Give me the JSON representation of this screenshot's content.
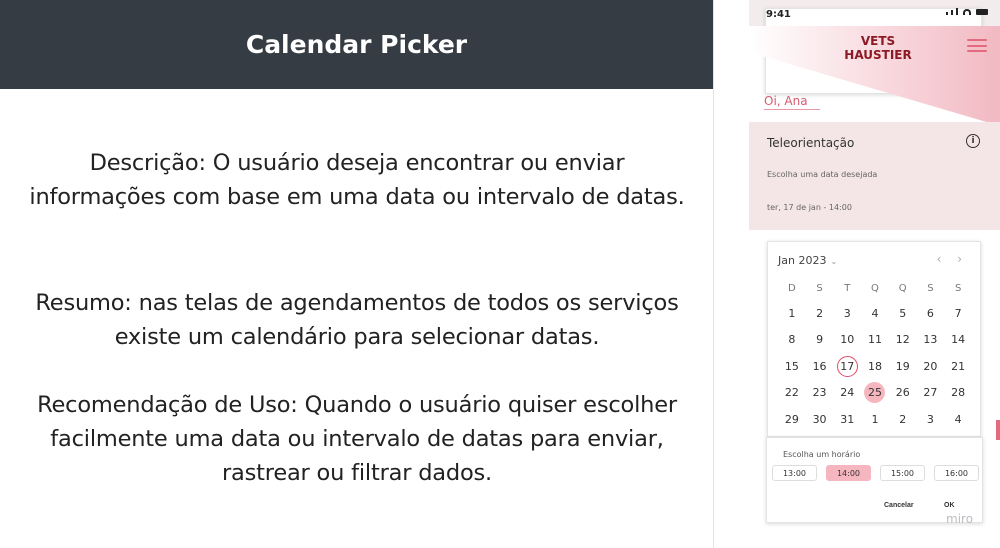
{
  "slide": {
    "title": "Calendar Picker",
    "description": "Descrição: O usuário deseja encontrar ou enviar informações com base em uma data ou intervalo de datas.",
    "summary": "Resumo: nas telas de agendamentos de todos os serviços existe um calendário para selecionar datas.",
    "recommendation": "Recomendação de Uso: Quando o usuário quiser escolher facilmente uma data ou intervalo de datas para enviar, rastrear ou filtrar dados."
  },
  "phone": {
    "status_time": "9:41",
    "logo_line1": "VETS",
    "logo_line2": "HAUSTIER",
    "greeting": "Oi, Ana",
    "card": {
      "title": "Teleorientação",
      "info_icon": "i",
      "prompt": "Escolha uma data desejada",
      "selected": "ter, 17 de jan  -  14:00"
    },
    "calendar": {
      "month": "Jan 2023",
      "month_caret": "⌄",
      "nav": "‹ ›",
      "weekdays": [
        "D",
        "S",
        "T",
        "Q",
        "Q",
        "S",
        "S"
      ],
      "weeks": [
        [
          "1",
          "2",
          "3",
          "4",
          "5",
          "6",
          "7"
        ],
        [
          "8",
          "9",
          "10",
          "11",
          "12",
          "13",
          "14"
        ],
        [
          "15",
          "16",
          "17",
          "18",
          "19",
          "20",
          "21"
        ],
        [
          "22",
          "23",
          "24",
          "25",
          "26",
          "27",
          "28"
        ],
        [
          "29",
          "30",
          "31",
          "1",
          "2",
          "3",
          "4"
        ]
      ],
      "today": "17",
      "selected": "25"
    },
    "time": {
      "label": "Escolha um horário",
      "slots": [
        "13:00",
        "14:00",
        "15:00",
        "16:00"
      ],
      "active_slot": "14:00",
      "cancel": "Cancelar",
      "ok": "OK"
    }
  },
  "watermark": "miro",
  "colors": {
    "header_bg": "#363c44",
    "accent": "#e46a80",
    "selected": "#f5b6c0",
    "logo": "#8c1a25"
  }
}
